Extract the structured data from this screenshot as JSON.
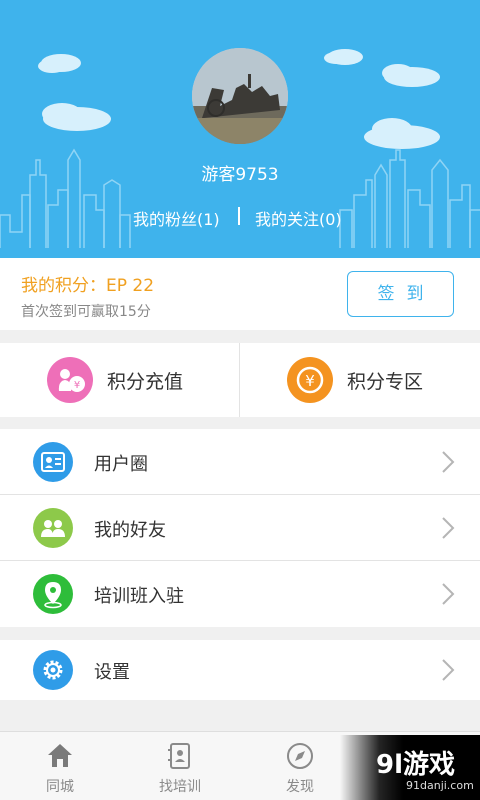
{
  "header": {
    "username": "游客9753",
    "fans_label": "我的粉丝(1)",
    "follows_label": "我的关注(0)",
    "background_color": "#3fb3ec"
  },
  "points": {
    "title": "我的积分：EP 22",
    "subtitle": "首次签到可赢取15分",
    "signin_label": "签到",
    "title_color": "#f0a020"
  },
  "shortcuts": [
    {
      "label": "积分充值",
      "icon": "money-bag-icon",
      "color": "#ee6fb8"
    },
    {
      "label": "积分专区",
      "icon": "yen-coin-icon",
      "color": "#f49320"
    }
  ],
  "menu": [
    {
      "label": "用户圈",
      "icon": "id-card-icon",
      "color": "#2f9ce8"
    },
    {
      "label": "我的好友",
      "icon": "friends-icon",
      "color": "#8dc94a"
    },
    {
      "label": "培训班入驻",
      "icon": "location-pin-icon",
      "color": "#2ebd3a"
    }
  ],
  "settings": {
    "label": "设置",
    "icon": "gear-icon",
    "color": "#2f9ce8"
  },
  "tabs": [
    {
      "label": "同城",
      "icon": "home-icon"
    },
    {
      "label": "找培训",
      "icon": "contacts-book-icon"
    },
    {
      "label": "发现",
      "icon": "compass-icon"
    }
  ],
  "watermark": {
    "logo": "9l游戏",
    "url": "91danji.com"
  }
}
